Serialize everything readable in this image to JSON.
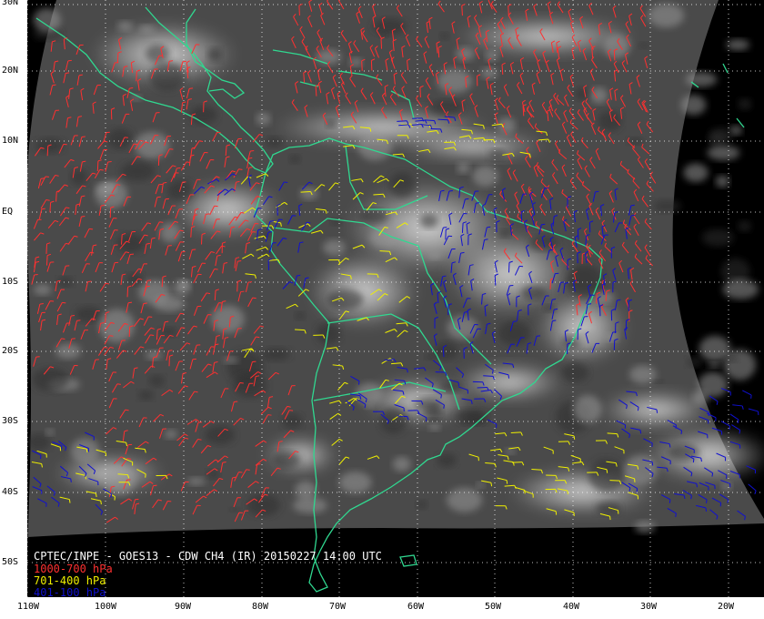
{
  "caption": "CPTEC/INPE - GOES13 - CDW CH4 (IR) 20150227 14:00 UTC",
  "legend": [
    {
      "label": "1000-700 hPa",
      "color": "#ff3030"
    },
    {
      "label": "701-400 hPa",
      "color": "#f0f000"
    },
    {
      "label": "401-100 hPa",
      "color": "#1010d0"
    }
  ],
  "lat_labels": [
    "30N",
    "20N",
    "10N",
    "EQ",
    "10S",
    "20S",
    "30S",
    "40S",
    "50S"
  ],
  "lon_labels": [
    "110W",
    "100W",
    "90W",
    "80W",
    "70W",
    "60W",
    "50W",
    "40W",
    "30W",
    "20W"
  ],
  "colors": {
    "frame": "#000000",
    "background": "#ffffff",
    "space": "#000000",
    "cloud_base": "#4a4a4a",
    "coastline": "#30d890",
    "gridline": "#ffffff"
  }
}
